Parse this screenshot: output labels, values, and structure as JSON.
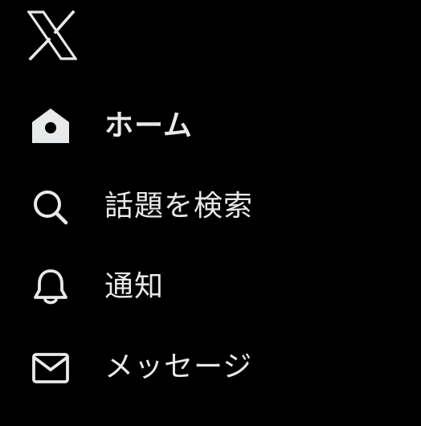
{
  "logo": {
    "icon": "x-logo-icon",
    "color": "#e7e9ea"
  },
  "nav": {
    "items": [
      {
        "label": "ホーム",
        "icon": "home-icon",
        "active": true
      },
      {
        "label": "話題を検索",
        "icon": "search-icon",
        "active": false
      },
      {
        "label": "通知",
        "icon": "bell-icon",
        "active": false
      },
      {
        "label": "メッセージ",
        "icon": "mail-icon",
        "active": false
      }
    ]
  },
  "colors": {
    "background": "#000000",
    "text": "#e7e9ea"
  }
}
